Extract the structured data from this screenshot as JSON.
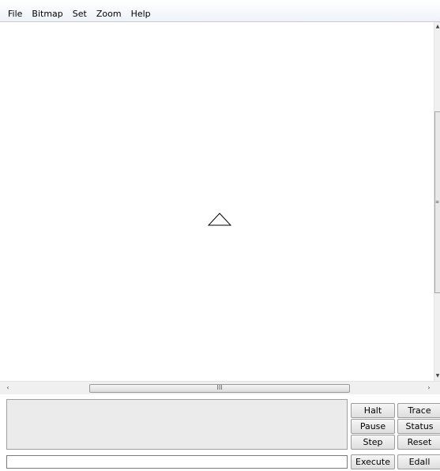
{
  "menu": {
    "items": [
      {
        "label": "File"
      },
      {
        "label": "Bitmap"
      },
      {
        "label": "Set"
      },
      {
        "label": "Zoom"
      },
      {
        "label": "Help"
      }
    ]
  },
  "canvas": {
    "turtle_icon": "triangle-turtle-icon"
  },
  "scrollbars": {
    "horizontal_grip": "III",
    "left_arrow": "‹",
    "right_arrow": "›",
    "up_arrow": "▲",
    "down_arrow": "▼",
    "vertical_grip": "≡"
  },
  "commander": {
    "input_value": "",
    "buttons": {
      "halt": "Halt",
      "trace": "Trace",
      "pause": "Pause",
      "status": "Status",
      "step": "Step",
      "reset": "Reset",
      "execute": "Execute",
      "edall": "Edall"
    }
  }
}
